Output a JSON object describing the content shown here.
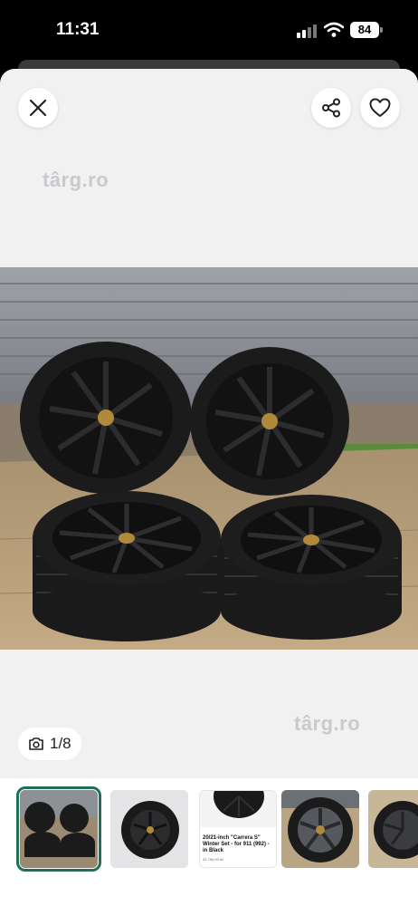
{
  "status": {
    "time": "11:31",
    "battery": "84"
  },
  "header": {
    "close_icon": "close-icon",
    "share_icon": "share-icon",
    "favorite_icon": "heart-icon"
  },
  "watermarks": {
    "top": "târg.ro",
    "bottom": "târg.ro"
  },
  "gallery": {
    "counter": "1/8",
    "camera_icon": "camera-icon"
  },
  "thumbnails": {
    "items": [
      {
        "selected": true
      },
      {
        "selected": false
      },
      {
        "selected": false,
        "title": "20/21-inch \"Carrera S\" Winter Set - for 911 (992) - in Black",
        "price": "41.790,00 lei"
      },
      {
        "selected": false
      },
      {
        "selected": false
      }
    ]
  },
  "colors": {
    "accent": "#1f6f5a",
    "sheet": "#f1f1f2"
  }
}
